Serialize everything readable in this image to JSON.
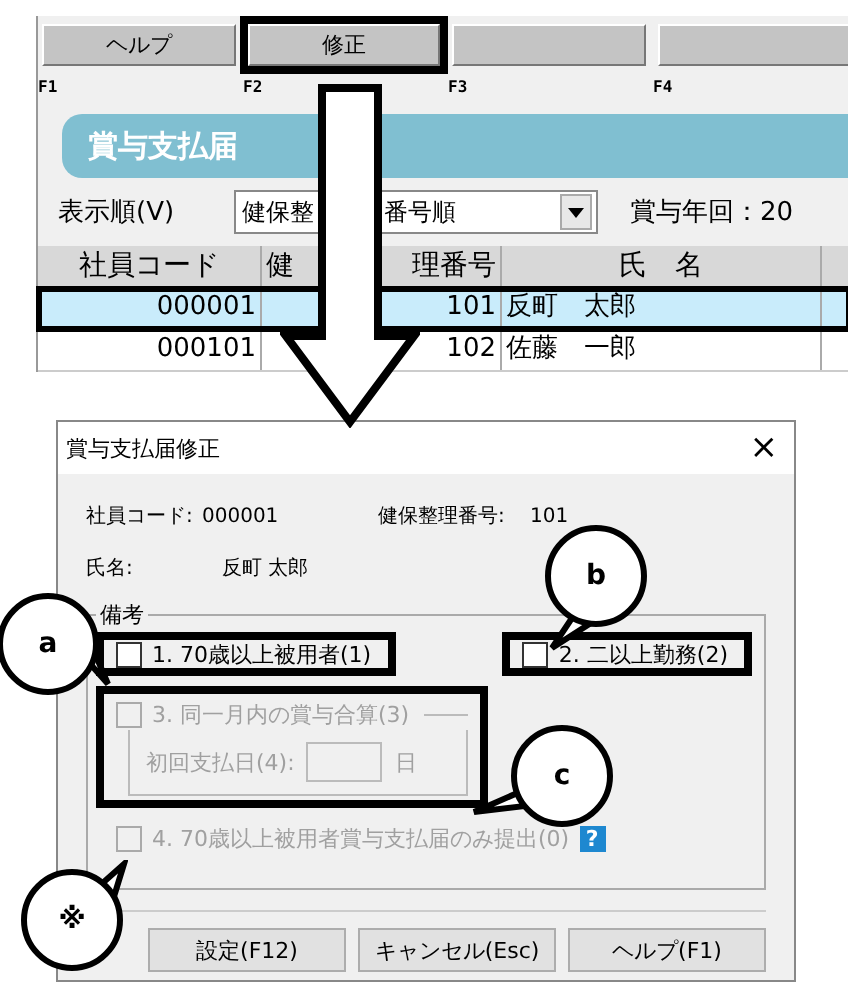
{
  "function_keys": [
    {
      "label": "ヘルプ",
      "key": "F1",
      "highlighted": false
    },
    {
      "label": "修正",
      "key": "F2",
      "highlighted": true
    },
    {
      "key": "F3",
      "highlighted": false
    },
    {
      "key": "F4",
      "highlighted": false
    }
  ],
  "screen_title": "賞与支払届",
  "sort": {
    "label": "表示順(V)",
    "value_parts": [
      "健保整",
      "番号順"
    ]
  },
  "bonus_year_label": "賞与年回：20",
  "table": {
    "columns": [
      {
        "parts": [
          "社員コード"
        ]
      },
      {
        "parts": [
          "健",
          "理番号"
        ]
      },
      {
        "parts": [
          "氏　名"
        ]
      }
    ],
    "rows": [
      {
        "cells": [
          "000001",
          "101",
          "反町　太郎"
        ],
        "selected": true
      },
      {
        "cells": [
          "000101",
          "102",
          "佐藤　一郎"
        ],
        "selected": false
      }
    ]
  },
  "dialog": {
    "title": "賞与支払届修正",
    "close": "×",
    "employee_code_label": "社員コード:",
    "employee_code": "000001",
    "insurance_no_label": "健保整理番号:",
    "insurance_no": "101",
    "name_label": "氏名:",
    "name": "反町 太郎",
    "group_label": "備考",
    "options": [
      {
        "label": "1. 70歳以上被用者(1)",
        "checked": false,
        "disabled": false,
        "highlighted": true
      },
      {
        "label": "2. 二以上勤務(2)",
        "checked": false,
        "disabled": false,
        "highlighted": true
      },
      {
        "label": "3. 同一月内の賞与合算(3)",
        "checked": false,
        "disabled": true,
        "highlighted": true,
        "date_label": "初回支払日(4):",
        "unit": "日"
      },
      {
        "label": "4. 70歳以上被用者賞与支払届のみ提出(0)",
        "checked": false,
        "disabled": true,
        "help": "?"
      }
    ],
    "buttons": [
      "設定(F12)",
      "キャンセル(Esc)",
      "ヘルプ(F1)"
    ]
  },
  "callouts": [
    {
      "label": "a"
    },
    {
      "label": "b"
    },
    {
      "label": "c"
    },
    {
      "label": "※"
    }
  ]
}
